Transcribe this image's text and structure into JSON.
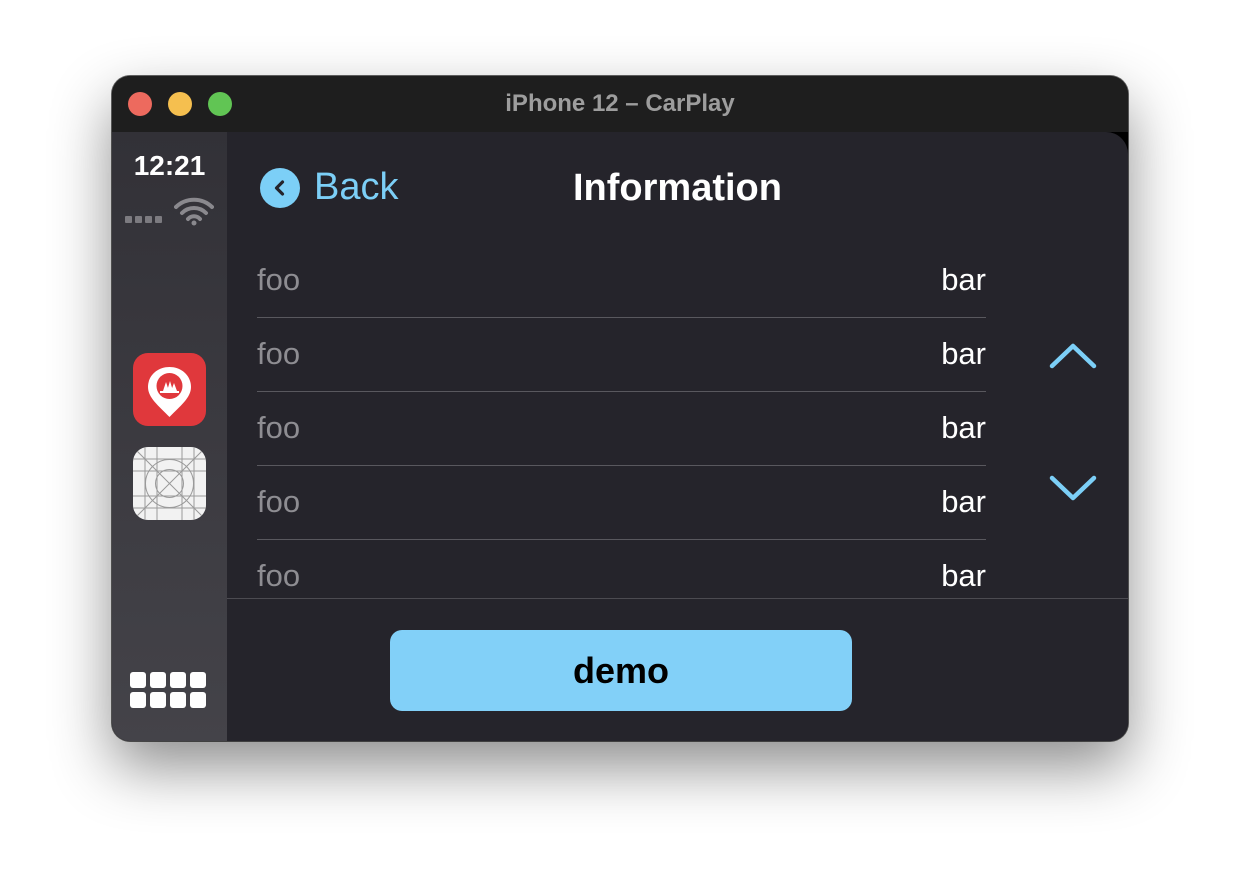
{
  "window": {
    "title": "iPhone 12 – CarPlay"
  },
  "status": {
    "time": "12:21"
  },
  "sidebar": {
    "apps": [
      {
        "icon": "map-pin-tree-icon",
        "color": "#e0383c"
      },
      {
        "icon": "app-grid-placeholder-icon",
        "color": "#f2f2f2"
      }
    ],
    "home_icon": "apps-grid-icon"
  },
  "navbar": {
    "back_label": "Back",
    "title": "Information"
  },
  "list": {
    "rows": [
      {
        "key": "foo",
        "value": "bar"
      },
      {
        "key": "foo",
        "value": "bar"
      },
      {
        "key": "foo",
        "value": "bar"
      },
      {
        "key": "foo",
        "value": "bar"
      },
      {
        "key": "foo",
        "value": "bar"
      }
    ]
  },
  "action": {
    "button_label": "demo"
  },
  "colors": {
    "accent": "#7ccff7",
    "button": "#82d0f8",
    "background": "#25242b"
  }
}
